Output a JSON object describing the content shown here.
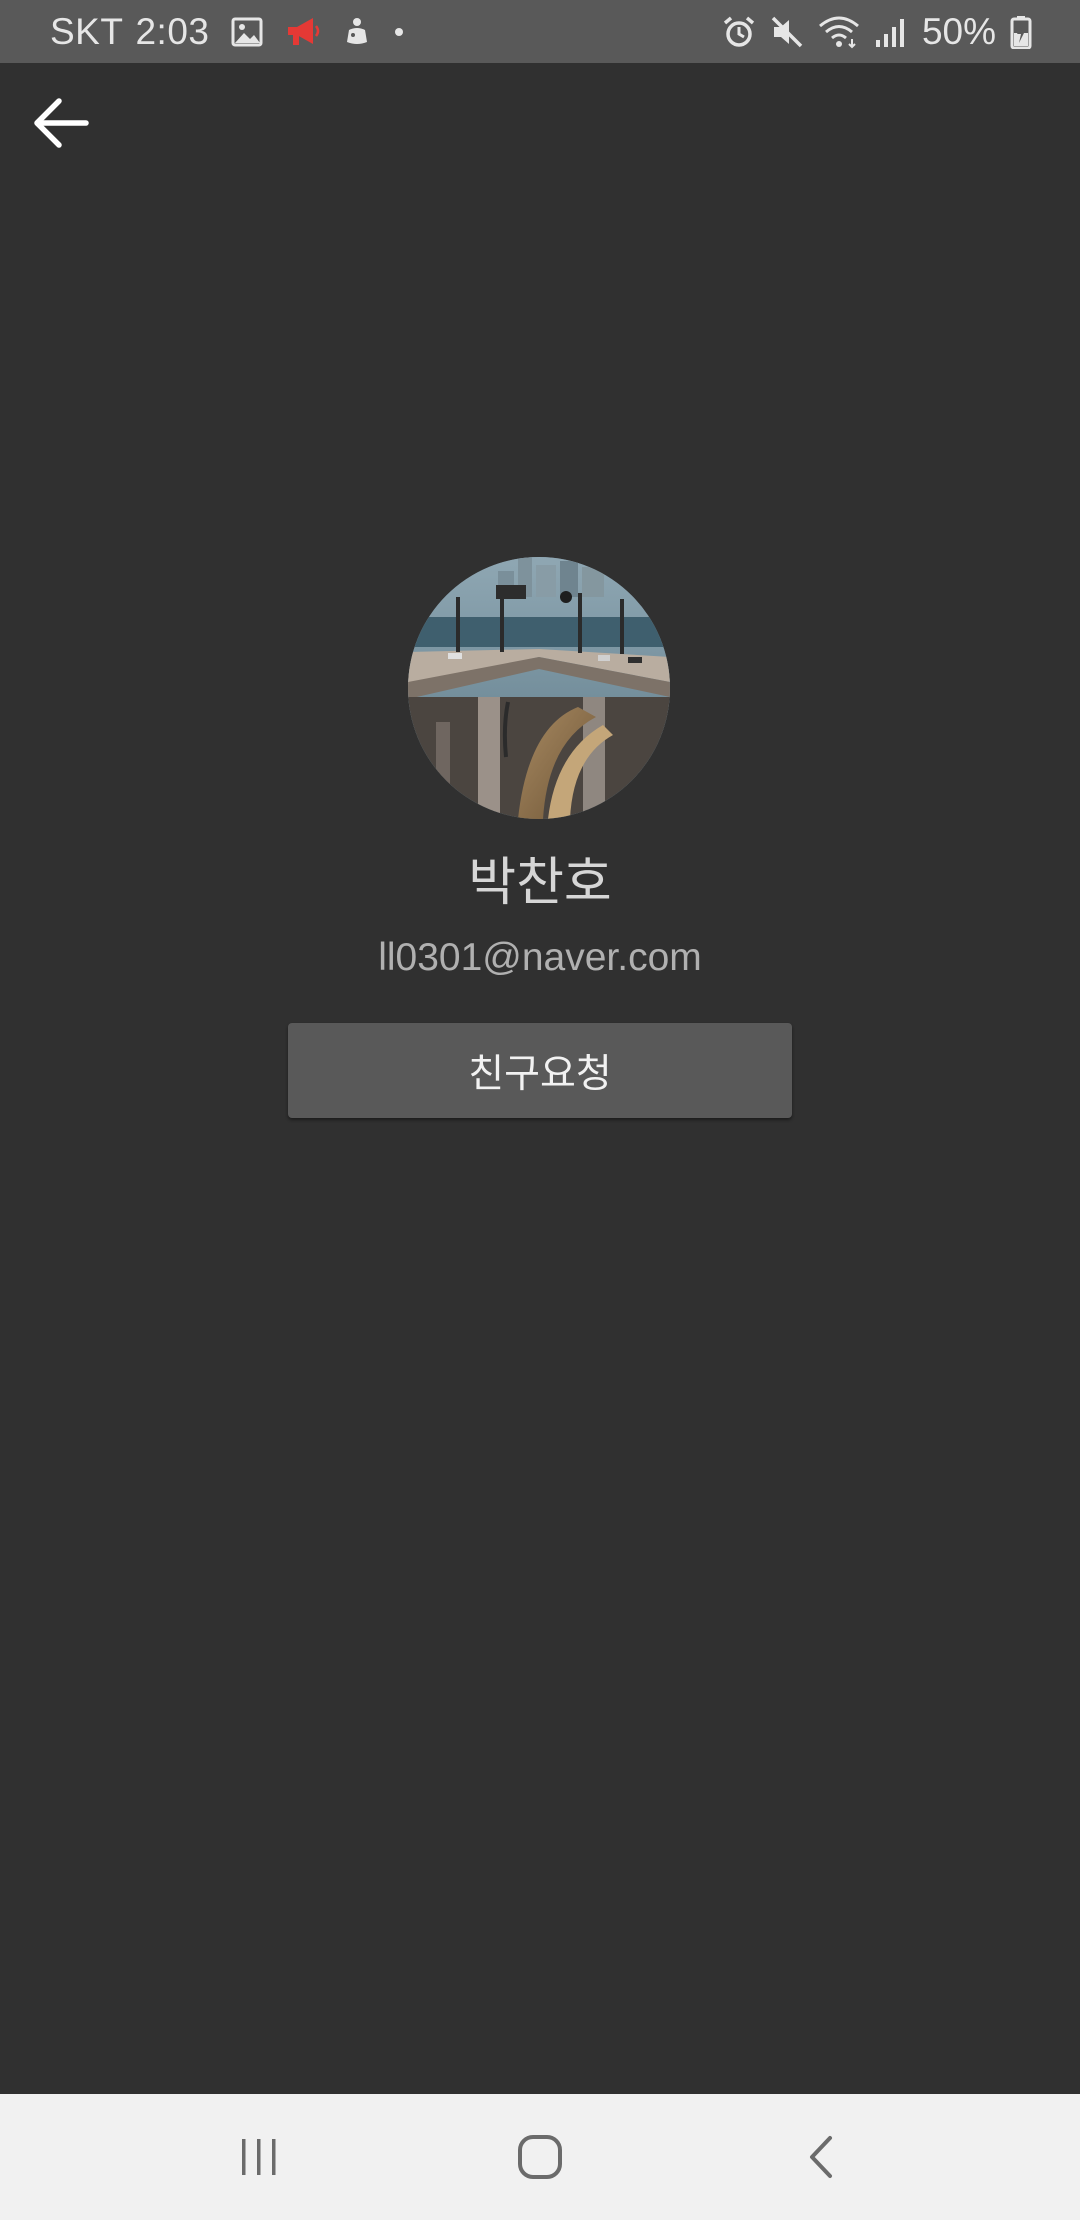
{
  "status_bar": {
    "carrier": "SKT",
    "time": "2:03",
    "battery_percent": "50%",
    "left_icons": [
      "gallery-icon",
      "megaphone-icon",
      "app-notification-icon",
      "more-dot-icon"
    ],
    "right_icons": [
      "alarm-icon",
      "mute-icon",
      "wifi-icon",
      "signal-icon",
      "battery-charging-icon"
    ],
    "accent_red": "#e53935"
  },
  "app_bar": {
    "back_icon": "arrow-back-icon"
  },
  "profile": {
    "name": "박찬호",
    "email": "ll0301@naver.com",
    "avatar_icon": "profile-photo"
  },
  "actions": {
    "friend_request_label": "친구요청"
  },
  "nav_bar": {
    "buttons": [
      "recents-icon",
      "home-icon",
      "back-icon"
    ]
  },
  "colors": {
    "background": "#303030",
    "status_bar": "#595959",
    "button": "#595959",
    "nav_bar": "#f1f1f1"
  }
}
